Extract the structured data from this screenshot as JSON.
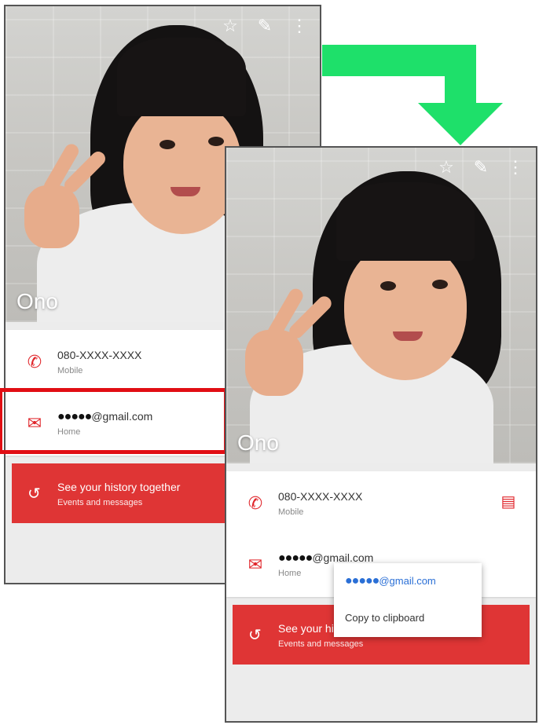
{
  "screen_before": {
    "contact_name": "Ono",
    "phone": {
      "number": "080-XXXX-XXXX",
      "type": "Mobile"
    },
    "email": {
      "address_suffix": "@gmail.com",
      "masked": "●●●●●",
      "type": "Home"
    },
    "history": {
      "title": "See your history together",
      "subtitle": "Events and messages"
    }
  },
  "screen_after": {
    "contact_name": "Ono",
    "phone": {
      "number": "080-XXXX-XXXX",
      "type": "Mobile"
    },
    "email": {
      "address_suffix": "@gmail.com",
      "masked": "●●●●●",
      "type": "Home"
    },
    "history": {
      "title": "See your history together",
      "subtitle": "Events and messages"
    },
    "context_menu": {
      "email_masked": "●●●●●",
      "email_suffix": "@gmail.com",
      "copy_label": "Copy to clipboard"
    }
  },
  "icons": {
    "star": "star-icon",
    "edit": "pencil-icon",
    "more": "more-vert-icon",
    "phone": "phone-icon",
    "email": "email-icon",
    "history": "history-icon",
    "message": "message-icon"
  },
  "colors": {
    "accent_red": "#df3535",
    "highlight_red": "#e10e14",
    "arrow_green": "#1ee06a",
    "link_blue": "#2a6fd6"
  }
}
